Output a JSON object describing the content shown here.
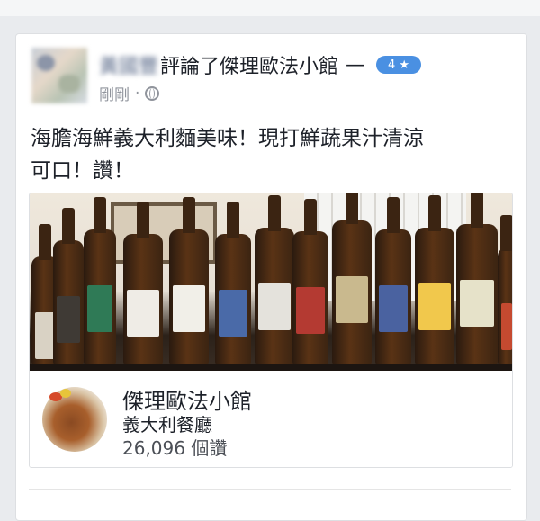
{
  "post": {
    "author_name": "黃國豐",
    "action_text": "評論了傑理歐法小館",
    "dash": "—",
    "rating_badge": "4 ★",
    "timestamp": "剛剛",
    "separator": "·",
    "privacy_icon": "globe-icon",
    "body_line1": "海膽海鮮義大利麵美味！現打鮮蔬果汁清涼",
    "body_line2": "可口！讚！"
  },
  "link_card": {
    "image_description_icon": "beer-bottles-photo",
    "page_name": "傑理歐法小館",
    "category": "義大利餐廳",
    "likes_text": "26,096 個讚"
  },
  "colors": {
    "badge": "#4a90e2",
    "text": "#1d2129",
    "meta": "#90949c",
    "background": "#e9ebee"
  }
}
